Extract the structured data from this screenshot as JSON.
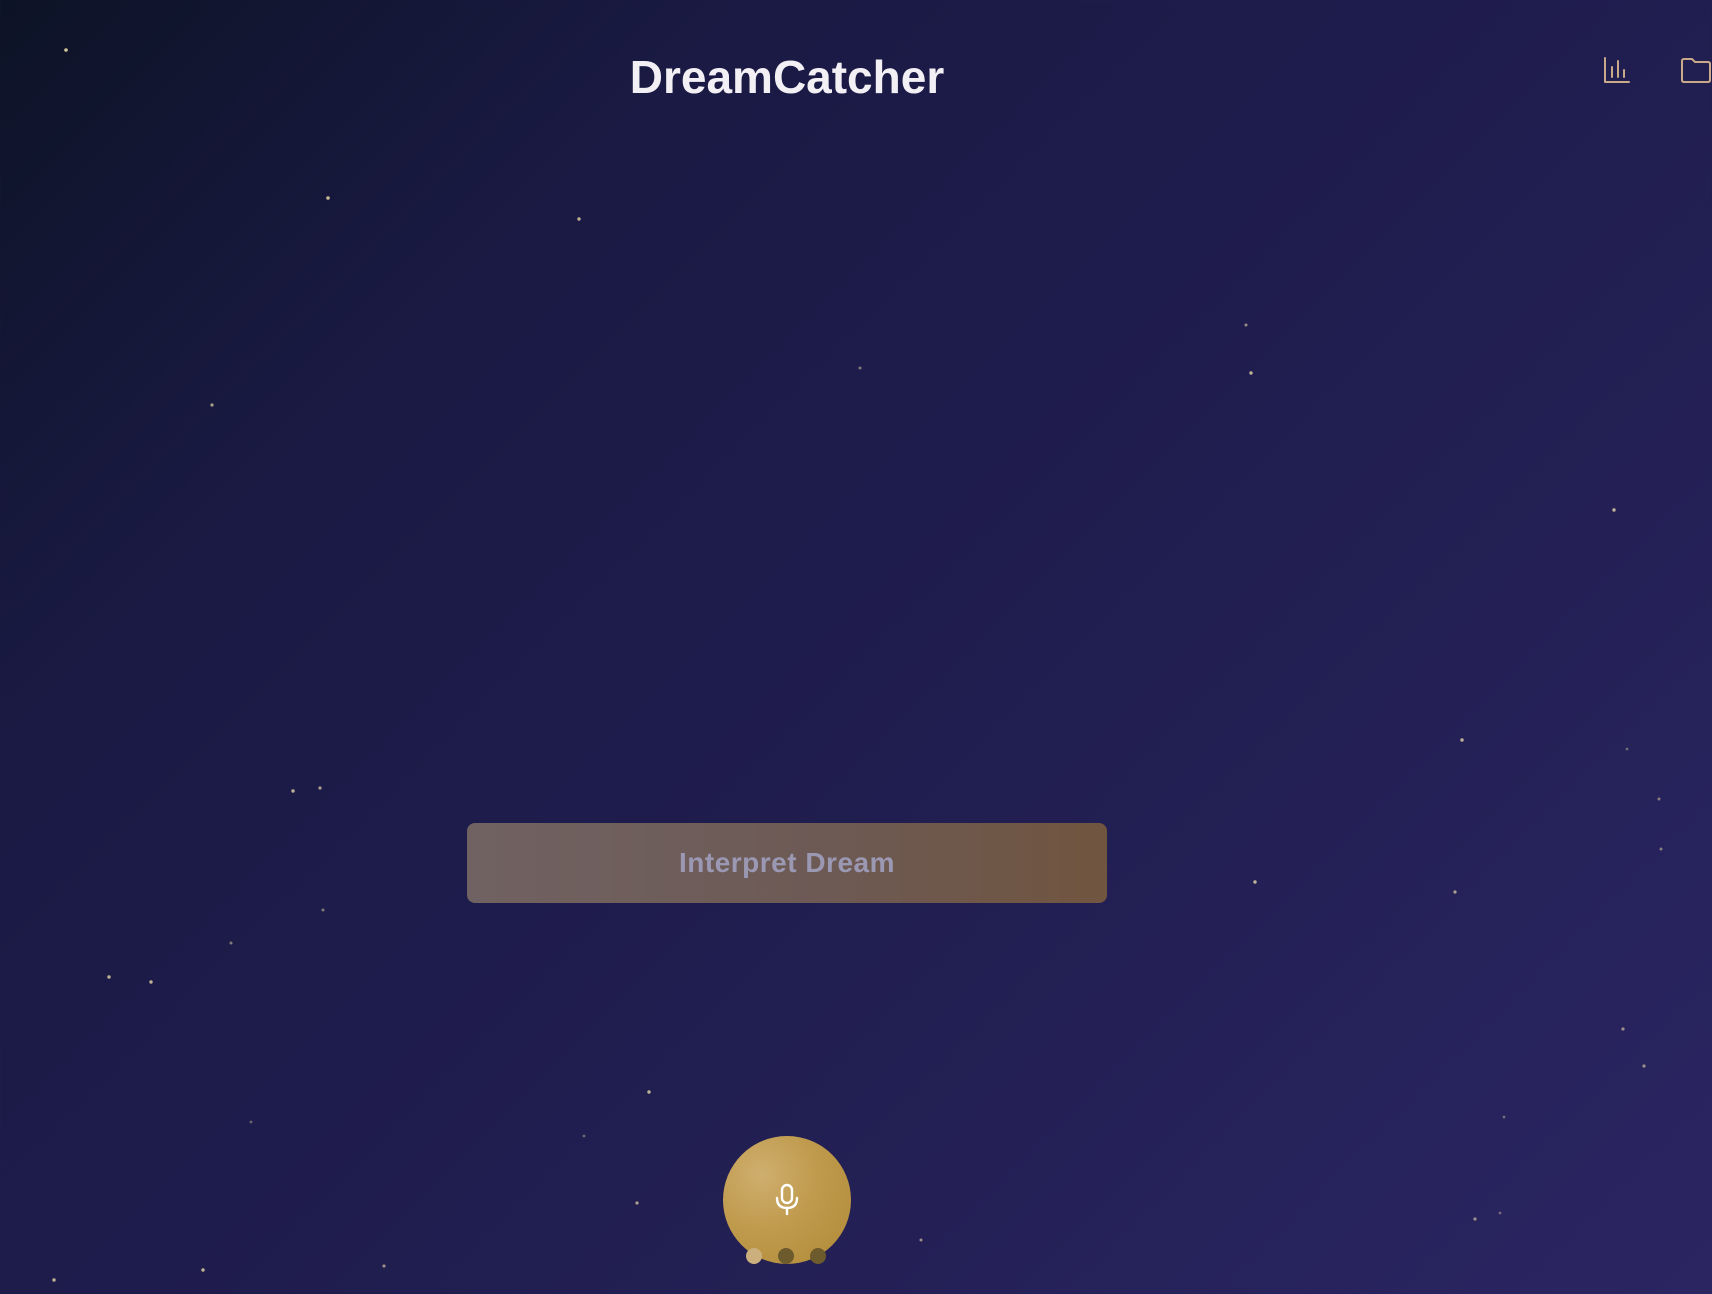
{
  "header": {
    "title": "DreamCatcher",
    "stats_icon": "bar-chart-icon",
    "folder_icon": "folder-icon"
  },
  "main": {
    "interpret_button_label": "Interpret Dream",
    "record_icon": "microphone-icon"
  },
  "pager": {
    "total": 3,
    "active_index": 0
  },
  "colors": {
    "accent_gold": "#c2a05a",
    "title_text": "#f2f0f4",
    "background_dark": "#0d1326",
    "background_light": "#2b2562",
    "icon_tint": "#c9a98a"
  }
}
